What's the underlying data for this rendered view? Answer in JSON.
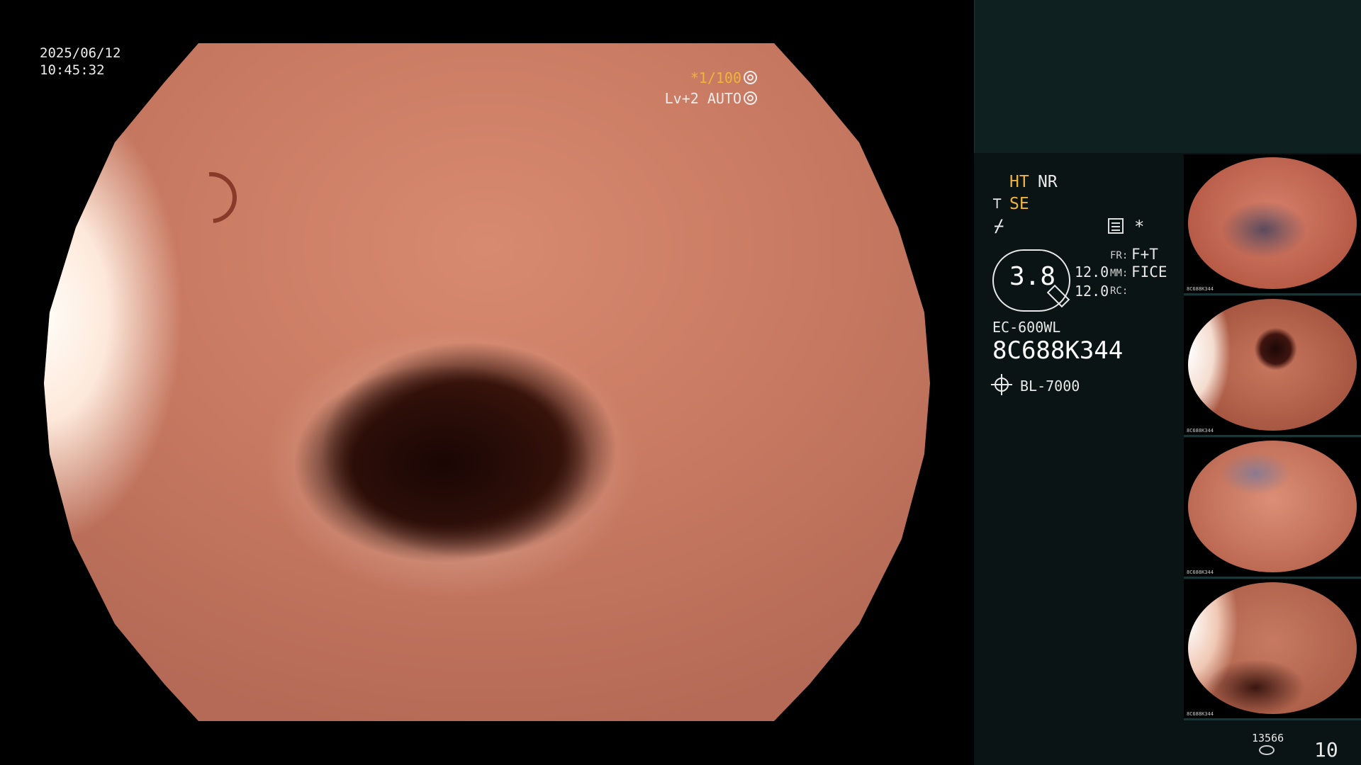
{
  "overlay": {
    "date": "2025/06/12",
    "time": "10:45:32",
    "shutter": "*1/100",
    "iris": "Lv+2 AUTO"
  },
  "panel": {
    "ht": "HT",
    "nr": "NR",
    "se": "SE",
    "star": "*",
    "zoom_value": "3.8",
    "value1": "12.0",
    "value2": "12.0",
    "fr_key": "FR:",
    "fr_value": "F+T",
    "mm_key": "MM:",
    "mm_value": "FICE",
    "rc_key": "RC:",
    "scope_model": "EC-600WL",
    "serial": "8C688K344",
    "light_source": "BL-7000",
    "disk_count": "13566",
    "page_number": "10"
  },
  "thumbnails": [
    {
      "serial": "8C688K344"
    },
    {
      "serial": "8C688K344"
    },
    {
      "serial": "8C688K344"
    },
    {
      "serial": "8C688K344"
    }
  ],
  "colors": {
    "accent": "#f0b43c",
    "panel_bg": "#0b1414",
    "panel_top": "#0e2020"
  }
}
